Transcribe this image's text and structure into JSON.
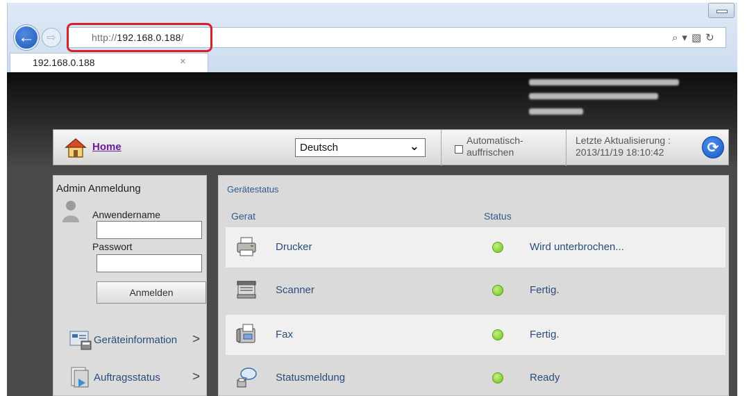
{
  "browser": {
    "address_prefix": "http://",
    "address_host": "192.168.0.188",
    "address_suffix": "/",
    "tab_title": "192.168.0.188",
    "tab_close": "×",
    "back_icon": "←",
    "forward_icon": "⇨",
    "search_icon": "⌕",
    "dropdown_icon": "▾",
    "compat_icon": "▧",
    "reload_icon": "↻",
    "highlight_color": "#d6212a"
  },
  "toolbar": {
    "home_label": "Home",
    "language_selected": "Deutsch",
    "auto_refresh_line1": "Automatisch-",
    "auto_refresh_line2": "auffrischen",
    "last_update_line1": "Letzte Aktualisierung :",
    "last_update_line2": "2013/11/19 18:10:42"
  },
  "login": {
    "title": "Admin Anmeldung",
    "username_label": "Anwendername",
    "password_label": "Passwort",
    "login_button": "Anmelden"
  },
  "nav": {
    "items": [
      {
        "label": "Geräteinformation",
        "icon": "device-info-icon"
      },
      {
        "label": "Auftragsstatus",
        "icon": "job-status-icon"
      }
    ]
  },
  "status": {
    "title": "Gerätestatus",
    "col_device": "Gerat",
    "col_status": "Status",
    "ok_color": "#6bbf1d",
    "rows": [
      {
        "device": "Drucker",
        "status": "Wird unterbrochen...",
        "icon": "printer-icon"
      },
      {
        "device": "Scanner",
        "status": "Fertig.",
        "icon": "scanner-icon"
      },
      {
        "device": "Fax",
        "status": "Fertig.",
        "icon": "fax-icon"
      },
      {
        "device": "Statusmeldung",
        "status": "Ready",
        "icon": "status-message-icon"
      }
    ]
  }
}
